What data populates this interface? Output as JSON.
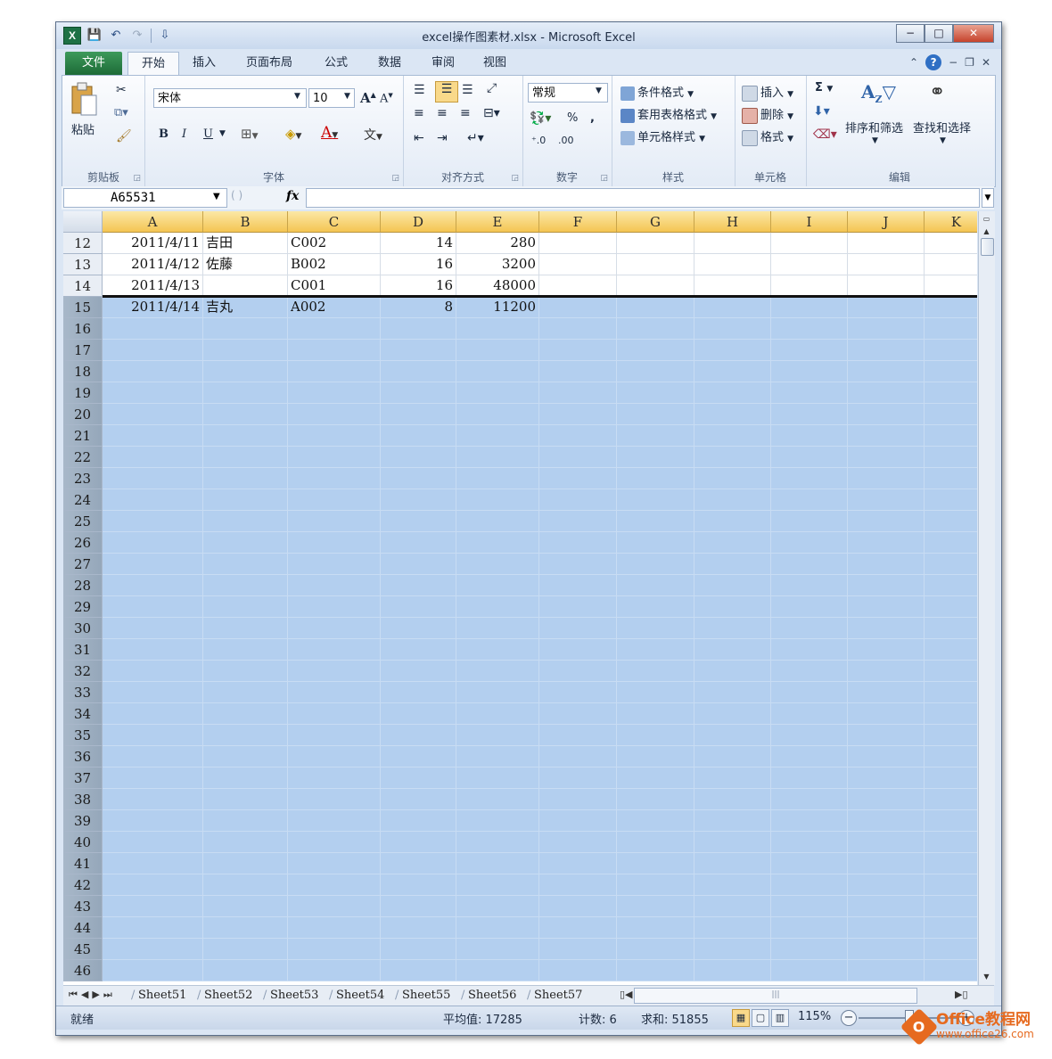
{
  "window": {
    "title": "excel操作图素材.xlsx - Microsoft Excel",
    "controls": [
      "−",
      "□",
      "✕"
    ]
  },
  "qat": {
    "app_icon": "X",
    "save": "💾",
    "undo": "↶",
    "redo": "↷",
    "customize": "⇩"
  },
  "tabs": {
    "file": "文件",
    "items": [
      "开始",
      "插入",
      "页面布局",
      "公式",
      "数据",
      "审阅",
      "视图"
    ]
  },
  "ribbon": {
    "clipboard": {
      "label": "剪贴板",
      "paste": "粘贴"
    },
    "font": {
      "label": "字体",
      "font_name": "宋体",
      "font_size": "10",
      "bold": "B",
      "italic": "I",
      "underline": "U"
    },
    "alignment": {
      "label": "对齐方式"
    },
    "number": {
      "label": "数字",
      "format": "常规",
      "percent": "%",
      "comma": ","
    },
    "styles": {
      "label": "样式",
      "conditional": "条件格式",
      "table": "套用表格格式",
      "cell": "单元格样式"
    },
    "cells": {
      "label": "单元格",
      "insert": "插入",
      "delete": "删除",
      "format": "格式"
    },
    "editing": {
      "label": "编辑",
      "sum": "Σ",
      "sort": "排序和筛选",
      "find": "查找和选择"
    }
  },
  "formula_bar": {
    "name_box": "A65531",
    "fx": "fx"
  },
  "columns": [
    "A",
    "B",
    "C",
    "D",
    "E",
    "F",
    "G",
    "H",
    "I",
    "J",
    "K"
  ],
  "rows": [
    {
      "n": "12",
      "cells": [
        "2011/4/11",
        "吉田",
        "C002",
        "14",
        "280"
      ]
    },
    {
      "n": "13",
      "cells": [
        "2011/4/12",
        "佐藤",
        "B002",
        "16",
        "3200"
      ]
    },
    {
      "n": "14",
      "cells": [
        "2011/4/13",
        "",
        "C001",
        "16",
        "48000"
      ]
    },
    {
      "n": "15",
      "cells": [
        "2011/4/14",
        "吉丸",
        "A002",
        "8",
        "11200"
      ]
    },
    {
      "n": "16",
      "cells": []
    },
    {
      "n": "17",
      "cells": []
    },
    {
      "n": "18",
      "cells": []
    },
    {
      "n": "19",
      "cells": []
    },
    {
      "n": "20",
      "cells": []
    },
    {
      "n": "21",
      "cells": []
    },
    {
      "n": "22",
      "cells": []
    },
    {
      "n": "23",
      "cells": []
    },
    {
      "n": "24",
      "cells": []
    },
    {
      "n": "25",
      "cells": []
    },
    {
      "n": "26",
      "cells": []
    },
    {
      "n": "27",
      "cells": []
    },
    {
      "n": "28",
      "cells": []
    },
    {
      "n": "29",
      "cells": []
    },
    {
      "n": "30",
      "cells": []
    },
    {
      "n": "31",
      "cells": []
    },
    {
      "n": "32",
      "cells": []
    },
    {
      "n": "33",
      "cells": []
    },
    {
      "n": "34",
      "cells": []
    },
    {
      "n": "35",
      "cells": []
    },
    {
      "n": "36",
      "cells": []
    },
    {
      "n": "37",
      "cells": []
    },
    {
      "n": "38",
      "cells": []
    },
    {
      "n": "39",
      "cells": []
    },
    {
      "n": "40",
      "cells": []
    },
    {
      "n": "41",
      "cells": []
    },
    {
      "n": "42",
      "cells": []
    },
    {
      "n": "43",
      "cells": []
    },
    {
      "n": "44",
      "cells": []
    },
    {
      "n": "45",
      "cells": []
    },
    {
      "n": "46",
      "cells": []
    }
  ],
  "selection": {
    "first_selected_row": "15"
  },
  "sheets": [
    "Sheet51",
    "Sheet52",
    "Sheet53",
    "Sheet54",
    "Sheet55",
    "Sheet56",
    "Sheet57"
  ],
  "status": {
    "mode": "就绪",
    "average": "平均值: 17285",
    "count": "计数: 6",
    "sum": "求和: 51855",
    "zoom": "115%"
  },
  "watermark": {
    "brand": "Office教程网",
    "url": "www.office26.com"
  },
  "colors": {
    "selection": "#b3cfef",
    "header_selected": "#f4c553",
    "file_tab": "#1d6b37"
  }
}
